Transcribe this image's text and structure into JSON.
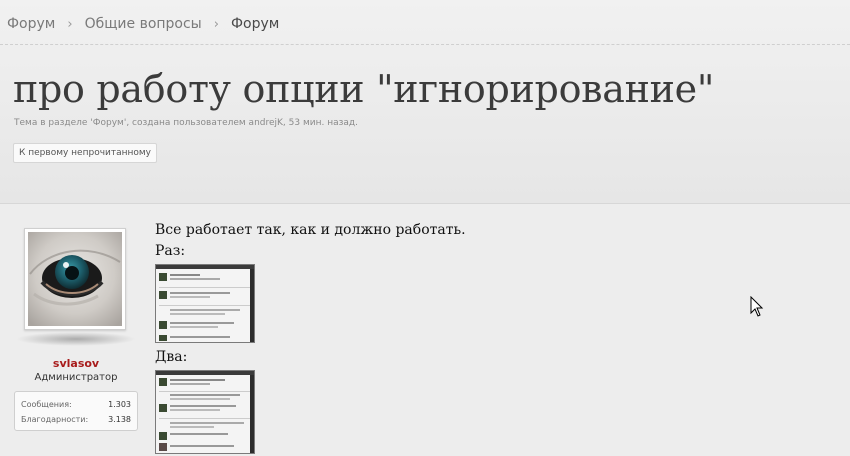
{
  "breadcrumb": {
    "items": [
      {
        "label": "Форум"
      },
      {
        "label": "Общие вопросы"
      },
      {
        "label": "Форум"
      }
    ]
  },
  "thread": {
    "title": "про работу опции \"игнорирование\"",
    "meta": "Тема в разделе 'Форум', создана пользователем andrejK, 53 мин. назад.",
    "first_unread_button": "К первому непрочитанному"
  },
  "post": {
    "author": {
      "username": "svlasov",
      "role": "Администратор",
      "stats": [
        {
          "label": "Сообщения:",
          "value": "1.303"
        },
        {
          "label": "Благодарности:",
          "value": "3.138"
        }
      ]
    },
    "message": {
      "text": "Все работает так, как и должно работать.",
      "label_one": "Раз:",
      "label_two": "Два:"
    }
  },
  "colors": {
    "username": "#a81c1c",
    "header_bg": "#e9e9e9",
    "content_bg": "#ededed"
  }
}
